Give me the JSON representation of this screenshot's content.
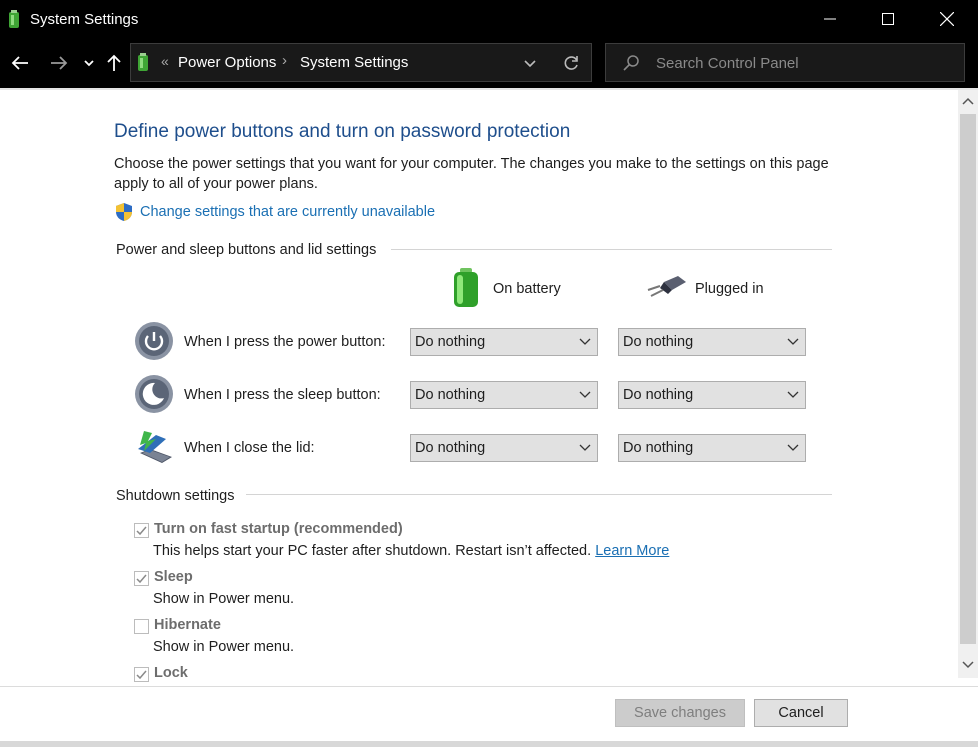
{
  "window": {
    "title": "System Settings",
    "minimize": "minimize",
    "maximize": "maximize",
    "close": "close"
  },
  "address": {
    "overflow_glyph": "«",
    "crumbs": [
      "Power Options",
      "System Settings"
    ],
    "separator": "›"
  },
  "search": {
    "placeholder": "Search Control Panel"
  },
  "page": {
    "heading": "Define power buttons and turn on password protection",
    "description": "Choose the power settings that you want for your computer. The changes you make to the settings on this page apply to all of your power plans.",
    "change_link": "Change settings that are currently unavailable"
  },
  "buttons_section": {
    "title": "Power and sleep buttons and lid settings",
    "columns": [
      "On battery",
      "Plugged in"
    ],
    "rows": [
      {
        "label": "When I press the power button:",
        "battery": "Do nothing",
        "plugged": "Do nothing"
      },
      {
        "label": "When I press the sleep button:",
        "battery": "Do nothing",
        "plugged": "Do nothing"
      },
      {
        "label": "When I close the lid:",
        "battery": "Do nothing",
        "plugged": "Do nothing"
      }
    ]
  },
  "shutdown_section": {
    "title": "Shutdown settings",
    "items": [
      {
        "label": "Turn on fast startup (recommended)",
        "checked": true,
        "desc": "This helps start your PC faster after shutdown. Restart isn’t affected.",
        "link": "Learn More"
      },
      {
        "label": "Sleep",
        "checked": true,
        "desc": "Show in Power menu."
      },
      {
        "label": "Hibernate",
        "checked": false,
        "desc": "Show in Power menu."
      },
      {
        "label": "Lock",
        "checked": true
      }
    ]
  },
  "footer": {
    "save": "Save changes",
    "cancel": "Cancel"
  },
  "colors": {
    "heading": "#1e4e8c",
    "link": "#1a6fb3",
    "titlebar": "#000000"
  }
}
